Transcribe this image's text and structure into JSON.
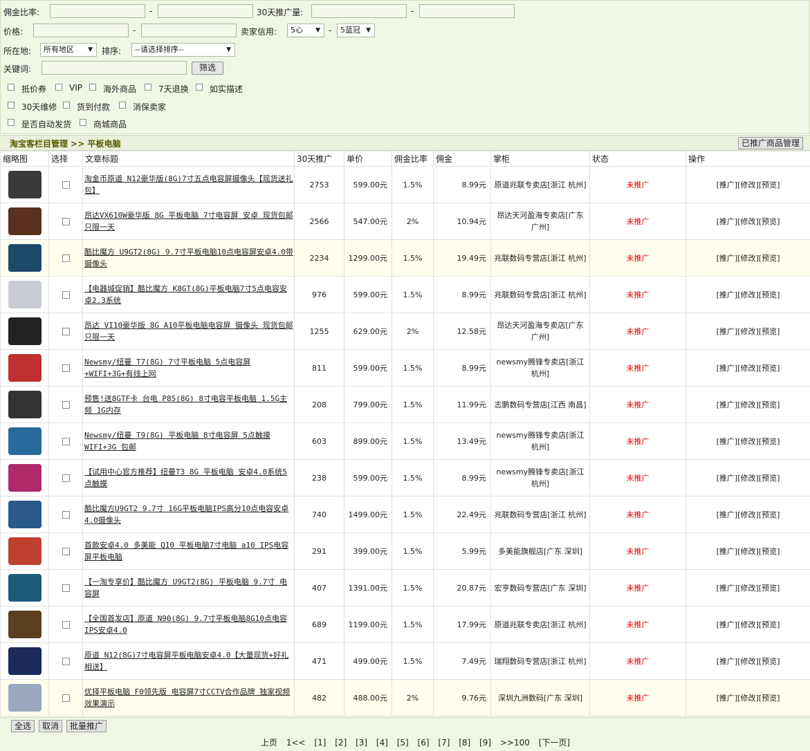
{
  "filters": {
    "commission_rate_label": "佣金比率:",
    "promo_volume_label": "30天推广量:",
    "price_label": "价格:",
    "seller_credit_label": "卖家信用:",
    "credit_min": "5心",
    "credit_max": "5蓝冠",
    "dash": "-",
    "location_label": "所在地:",
    "location_value": "所有地区",
    "sort_label": "排序:",
    "sort_value": "--请选择排序--",
    "keyword_label": "关键词:",
    "filter_button": "筛选",
    "checkboxes": [
      "抵价券",
      "VIP",
      "海外商品",
      "7天退换",
      "如实描述",
      "30天维修",
      "货到付款",
      "消保卖家",
      "是否自动发货",
      "商城商品"
    ]
  },
  "breadcrumb": "淘宝客栏目管理 >> 平板电脑",
  "manage_button": "已推广商品管理",
  "table": {
    "headers": [
      "缩略图",
      "选择",
      "文章标题",
      "30天推广",
      "单价",
      "佣金比率",
      "佣金",
      "掌柜",
      "状态",
      "操作"
    ],
    "rows": [
      {
        "title": "淘金币原道 N12豪华版(8G)7寸五点电容屏摄像头【现货送礼包】",
        "promo": "2753",
        "price": "599.00元",
        "rate": "1.5%",
        "commission": "8.99元",
        "shop": "原道兆联专卖店[浙江 杭州]",
        "status": "未推广"
      },
      {
        "title": "昂达VX610W豪华版 8G 平板电脑 7寸电容屏 安卓 现货包邮只限一天",
        "promo": "2566",
        "price": "547.00元",
        "rate": "2%",
        "commission": "10.94元",
        "shop": "昂达天河盈海专卖店[广东 广州]",
        "status": "未推广"
      },
      {
        "title": "酷比魔方 U9GT2(8G) 9.7寸平板电脑10点电容屏安卓4.0带摄像头",
        "promo": "2234",
        "price": "1299.00元",
        "rate": "1.5%",
        "commission": "19.49元",
        "shop": "兆联数码专营店[浙江 杭州]",
        "status": "未推广"
      },
      {
        "title": "【电器城促销】酷比魔方 K8GT(8G)平板电脑7寸5点电容安卓2.3系统",
        "promo": "976",
        "price": "599.00元",
        "rate": "1.5%",
        "commission": "8.99元",
        "shop": "兆联数码专营店[浙江 杭州]",
        "status": "未推广"
      },
      {
        "title": "昂达 VI10豪华版 8G A10平板电脑电容屏 摄像头 现货包邮只限一天",
        "promo": "1255",
        "price": "629.00元",
        "rate": "2%",
        "commission": "12.58元",
        "shop": "昂达天河盈海专卖店[广东 广州]",
        "status": "未推广"
      },
      {
        "title": "Newsmy/纽曼 T7(8G) 7寸平板电脑 5点电容屏+WIFI+3G+有线上网",
        "promo": "811",
        "price": "599.00元",
        "rate": "1.5%",
        "commission": "8.99元",
        "shop": "newsmy腾锋专卖店[浙江 杭州]",
        "status": "未推广"
      },
      {
        "title": "预售!送8GTF卡 台电 P85(8G) 8寸电容平板电脑 1.5G主频 1G内存",
        "promo": "208",
        "price": "799.00元",
        "rate": "1.5%",
        "commission": "11.99元",
        "shop": "志鹏数码专营店[江西 南昌]",
        "status": "未推广"
      },
      {
        "title": "Newsmy/纽曼 T9(8G) 平板电脑 8寸电容屏 5点触摸WIFI+3G 包邮",
        "promo": "603",
        "price": "899.00元",
        "rate": "1.5%",
        "commission": "13.49元",
        "shop": "newsmy腾锋专卖店[浙江 杭州]",
        "status": "未推广"
      },
      {
        "title": "【试用中心官方推荐】纽曼T3 8G 平板电脑 安卓4.0系统5点触摸",
        "promo": "238",
        "price": "599.00元",
        "rate": "1.5%",
        "commission": "8.99元",
        "shop": "newsmy腾锋专卖店[浙江 杭州]",
        "status": "未推广"
      },
      {
        "title": "酷比魔方U9GT2 9.7寸 16G平板电脑IPS高分10点电容安卓4.0摄像头",
        "promo": "740",
        "price": "1499.00元",
        "rate": "1.5%",
        "commission": "22.49元",
        "shop": "兆联数码专营店[浙江 杭州]",
        "status": "未推广"
      },
      {
        "title": "首款安卓4.0 多美能 Q10 平板电脑7寸电脑 a10 IPS电容屏平板电脑",
        "promo": "291",
        "price": "399.00元",
        "rate": "1.5%",
        "commission": "5.99元",
        "shop": "多美能旗舰店[广东 深圳]",
        "status": "未推广"
      },
      {
        "title": "【一淘专享价】酷比魔方 U9GT2(8G) 平板电脑 9.7寸 电容屏",
        "promo": "407",
        "price": "1391.00元",
        "rate": "1.5%",
        "commission": "20.87元",
        "shop": "宏亨数码专营店[广东 深圳]",
        "status": "未推广"
      },
      {
        "title": "【全国首发店】原道 N90(8G) 9.7寸平板电脑8G10点电容IPS安卓4.0",
        "promo": "689",
        "price": "1199.00元",
        "rate": "1.5%",
        "commission": "17.99元",
        "shop": "原道兆联专卖店[浙江 杭州]",
        "status": "未推广"
      },
      {
        "title": "原道 N12(8G)7寸电容屏平板电脑安卓4.0【大量现货+好礼相送】",
        "promo": "471",
        "price": "499.00元",
        "rate": "1.5%",
        "commission": "7.49元",
        "shop": "瑞翔数码专营店[浙江 杭州]",
        "status": "未推广"
      },
      {
        "title": "优择平板电脑 F0领先版 电容屏7寸CCTV合作品牌 独家视频效果演示",
        "promo": "482",
        "price": "488.00元",
        "rate": "2%",
        "commission": "9.76元",
        "shop": "深圳九洲数码[广东 深圳]",
        "status": "未推广"
      }
    ],
    "ops": "[推广][修改][预览]"
  },
  "footer": {
    "select_all": "全选",
    "cancel": "取消",
    "batch_promote": "批量推广",
    "prev": "上页",
    "first": "1<<",
    "pages": [
      "[1]",
      "[2]",
      "[3]",
      "[4]",
      "[5]",
      "[6]",
      "[7]",
      "[8]",
      "[9]"
    ],
    "last": ">>100",
    "next": "[下一页]"
  }
}
